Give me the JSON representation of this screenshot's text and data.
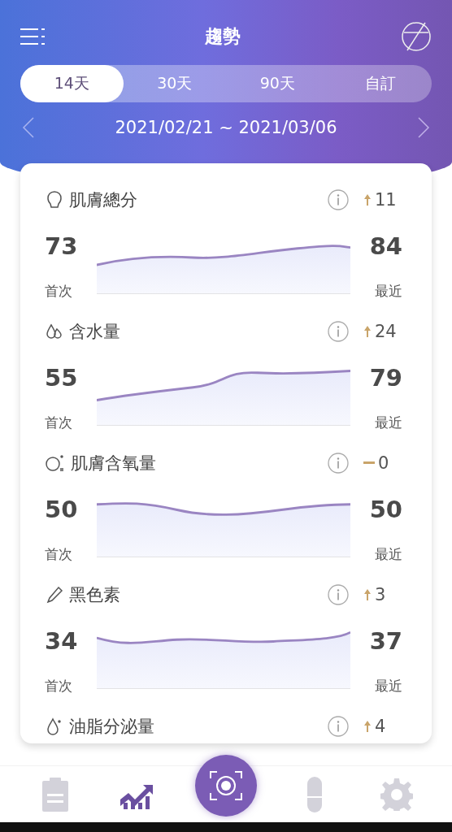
{
  "header": {
    "title": "趨勢"
  },
  "tabs": [
    {
      "label": "14天",
      "selected": true
    },
    {
      "label": "30天",
      "selected": false
    },
    {
      "label": "90天",
      "selected": false
    },
    {
      "label": "自訂",
      "selected": false
    }
  ],
  "date_range": "2021/02/21 ~ 2021/03/06",
  "metrics": [
    {
      "name": "肌膚總分",
      "kind": "up",
      "change": "11",
      "first": "73",
      "first_label": "首次",
      "latest": "84",
      "latest_label": "最近"
    },
    {
      "name": "含水量",
      "kind": "up",
      "change": "24",
      "first": "55",
      "first_label": "首次",
      "latest": "79",
      "latest_label": "最近"
    },
    {
      "name": "肌膚含氧量",
      "kind": "flat",
      "change": "0",
      "first": "50",
      "first_label": "首次",
      "latest": "50",
      "latest_label": "最近"
    },
    {
      "name": "黑色素",
      "kind": "up",
      "change": "3",
      "first": "34",
      "first_label": "首次",
      "latest": "37",
      "latest_label": "最近"
    },
    {
      "name": "油脂分泌量",
      "kind": "up",
      "change": "4"
    }
  ],
  "nav": [
    {
      "selected": false
    },
    {
      "selected": true
    },
    {
      "selected": false
    },
    {
      "selected": false
    },
    {
      "selected": false
    }
  ]
}
